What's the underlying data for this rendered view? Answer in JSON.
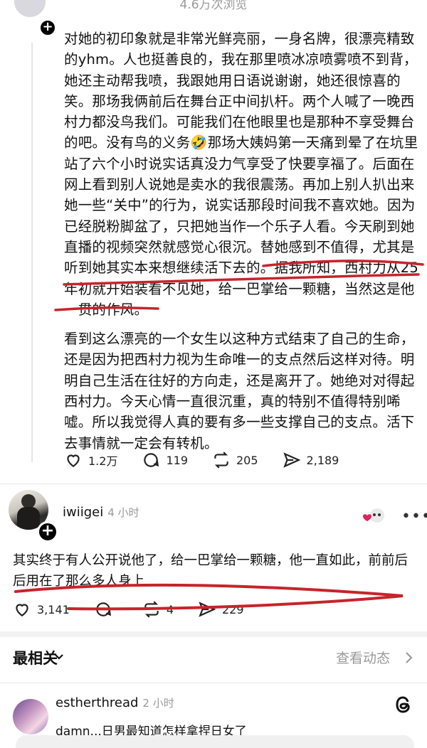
{
  "header": {
    "views_text": "4.6万次浏览"
  },
  "post": {
    "paragraphs": [
      "对她的初印象就是非常光鲜亮丽，一身名牌，很漂亮精致的yhm。人也挺善良的，我在那里喷冰凉喷雾喷不到背，她还主动帮我喷，我跟她用日语说谢谢，她还很惊喜的笑。那场我俩前后在舞台正中间扒杆。两个人喊了一晚西村力都没鸟我们。可能我们在他眼里也是那种不享受舞台的吧。没有鸟的义务🤣那场大姨妈第一天痛到晕了在坑里站了六个小时说实话真没力气享受了快要享福了。后面在网上看到别人说她是卖水的我很震荡。再加上别人扒出来她一些“关中”的行为，说实话那段时间我不喜欢她。因为已经脱粉脚盆了，只把她当作一个乐子人看。今天刷到她直播的视频突然就感觉心很沉。替她感到不值得，尤其是听到她其实本来想继续活下去的。据我所知，西村力从25年初就开始装看不见她，给一巴掌给一颗糖，当然这是他一贯的作风。",
      "看到这么漂亮的一个女生以这种方式结束了自己的生命，还是因为把西村力视为生命唯一的支点然后这样对待。明明自己生活在往好的方向走，还是离开了。她绝对对得起西村力。今天心情一直很沉重，真的特别不值得特别唏嘘。所以我觉得人真的要有多一些支撑自己的支点。活下去事情就一定会有转机。"
    ],
    "actions": {
      "likes": "1.2万",
      "comments": "119",
      "reposts": "205",
      "shares": "2,189"
    }
  },
  "reply": {
    "username": "iwiigei",
    "time": "4 小时",
    "text": "其实终于有人公开说他了，给一巴掌给一颗糖，他一直如此，前前后后用在了那么多人身上",
    "actions": {
      "likes": "3,141",
      "comments": "",
      "reposts": "4",
      "shares": "229"
    }
  },
  "section": {
    "title": "最相关",
    "link": "查看动态"
  },
  "comment": {
    "username": "estherthread",
    "time": "2 小时",
    "text": "damn...日男最知道怎样拿捏日女了"
  },
  "icons": {
    "like": "heart-icon",
    "comment": "comment-bubble-icon",
    "repost": "repost-icon",
    "share": "share-send-icon",
    "more": "more-dots-icon",
    "threads": "threads-logo-icon",
    "chevron": "chevron-right-icon",
    "plus": "plus-icon"
  },
  "colors": {
    "annotation_red": "#c6242b",
    "muted": "#9a9a9a"
  }
}
